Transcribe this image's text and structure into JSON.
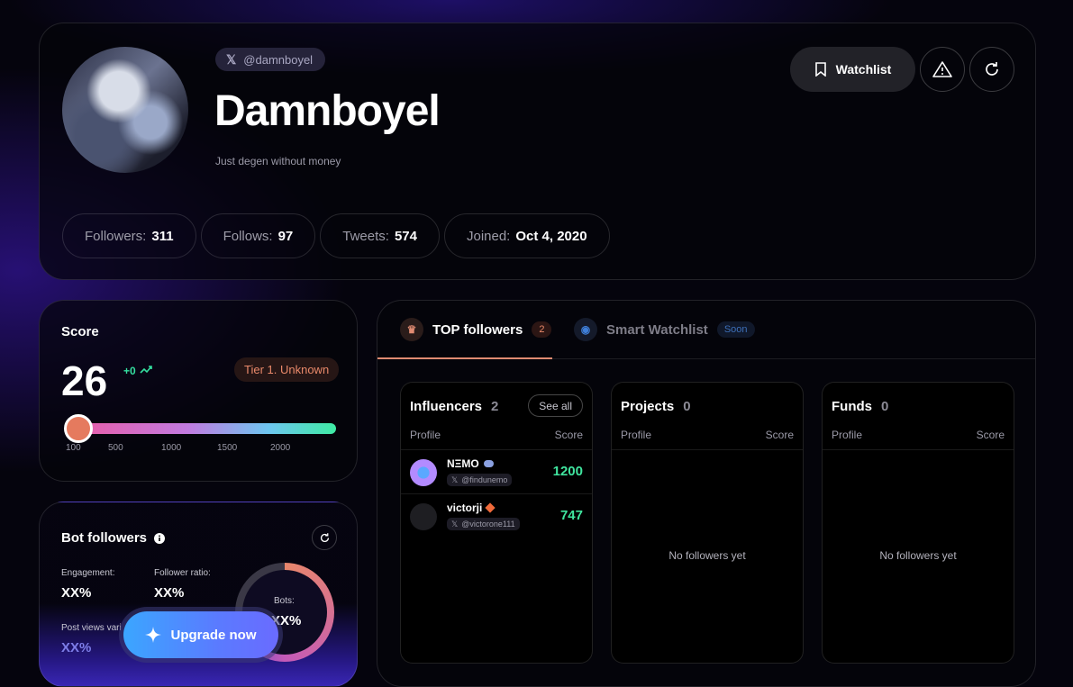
{
  "profile": {
    "handle": "@damnboyel",
    "name": "Damnboyel",
    "bio": "Just degen without money",
    "watchlist_label": "Watchlist",
    "stats": [
      {
        "label": "Followers:",
        "value": "311"
      },
      {
        "label": "Follows:",
        "value": "97"
      },
      {
        "label": "Tweets:",
        "value": "574"
      },
      {
        "label": "Joined:",
        "value": "Oct 4, 2020"
      }
    ]
  },
  "score": {
    "title": "Score",
    "value": "26",
    "delta": "+0",
    "tier": "Tier 1. Unknown",
    "ticks": [
      "100",
      "500",
      "1000",
      "1500",
      "2000"
    ],
    "colors": {
      "knob": "#e57a5e",
      "delta": "#35e0a1",
      "tier": "#e9896a"
    }
  },
  "bots": {
    "title": "Bot followers",
    "engagement_label": "Engagement:",
    "engagement_value": "XX%",
    "ratio_label": "Follower ratio:",
    "ratio_value": "XX%",
    "views_label": "Post views vari",
    "views_value": "XX%",
    "bots_label": "Bots:",
    "bots_value": "XX%",
    "upgrade_label": "Upgrade now"
  },
  "followers": {
    "tabs": [
      {
        "label": "TOP followers",
        "badge": "2",
        "active": true
      },
      {
        "label": "Smart Watchlist",
        "badge": "Soon",
        "active": false
      }
    ],
    "columns": {
      "profile": "Profile",
      "score": "Score"
    },
    "panels": {
      "influencers": {
        "title": "Influencers",
        "count": "2",
        "see_all": "See all",
        "rows": [
          {
            "name": "NΞMO",
            "handle": "@findunemo",
            "score": "1200"
          },
          {
            "name": "victorji",
            "handle": "@victorone111",
            "score": "747"
          }
        ]
      },
      "projects": {
        "title": "Projects",
        "count": "0",
        "empty": "No followers yet"
      },
      "funds": {
        "title": "Funds",
        "count": "0",
        "empty": "No followers yet"
      }
    }
  }
}
